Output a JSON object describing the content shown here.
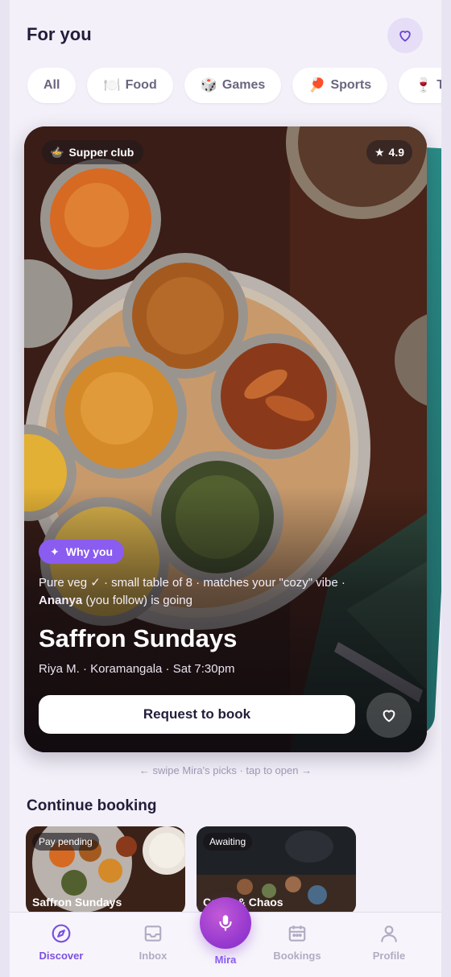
{
  "header": {
    "title": "For you"
  },
  "filters": [
    {
      "label": "All",
      "icon": ""
    },
    {
      "label": "Food",
      "icon": "🍽️"
    },
    {
      "label": "Games",
      "icon": "🎲"
    },
    {
      "label": "Sports",
      "icon": "🏓"
    },
    {
      "label": "Ta",
      "icon": "🍷"
    }
  ],
  "featured": {
    "category": "Supper club",
    "category_icon": "🍲",
    "rating": "4.9",
    "why_label": "Why you",
    "reason_line1": "Pure veg ✓ · small table of 8 · matches your \"cozy\" vibe ·",
    "reason_name": "Ananya",
    "reason_line2": " (you follow) is going",
    "title": "Saffron Sundays",
    "meta": "Riya M. · Koramangala · Sat 7:30pm",
    "cta": "Request to book"
  },
  "hint": "← swipe Mira's picks · tap to open →",
  "continue_booking": {
    "title": "Continue booking",
    "items": [
      {
        "status": "Pay pending",
        "name": "Saffron Sundays"
      },
      {
        "status": "Awaiting",
        "name": "Catan & Chaos"
      }
    ]
  },
  "tabs": {
    "discover": "Discover",
    "inbox": "Inbox",
    "mira": "Mira",
    "bookings": "Bookings",
    "profile": "Profile"
  },
  "colors": {
    "accent": "#7b4fe0",
    "why_badge": "#8a5cf0",
    "background": "#f3f0f9"
  }
}
